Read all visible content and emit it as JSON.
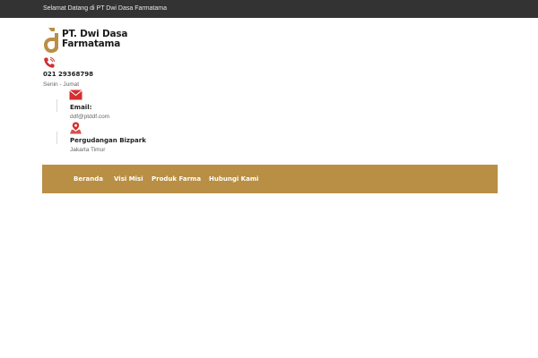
{
  "topbar": {
    "welcome_text": "Selamat Datang di PT Dwi Dasa Farmatama"
  },
  "logo": {
    "line1": "PT. Dwi Dasa",
    "line2": "Farmatama",
    "icon": "dd-logo-mark",
    "color": "#b88f44"
  },
  "contact": {
    "phone": {
      "icon": "phone-icon",
      "number": "021 29368798",
      "hours": "Senin - Jumat"
    },
    "email": {
      "icon": "envelope-icon",
      "label": "Email:",
      "value": "ddf@ptddf.com"
    },
    "address": {
      "icon": "map-pin-icon",
      "label": "Pergudangan Bizpark",
      "value": "Jakarta Timur"
    }
  },
  "nav": {
    "background": "#b88f44",
    "items": [
      {
        "label": "Beranda"
      },
      {
        "label": "Visi Misi"
      },
      {
        "label": "Produk Farma"
      },
      {
        "label": "Hubungi Kami"
      }
    ]
  },
  "colors": {
    "topbar": "#333333",
    "accent_red": "#d32f2f",
    "gold": "#b88f44"
  }
}
